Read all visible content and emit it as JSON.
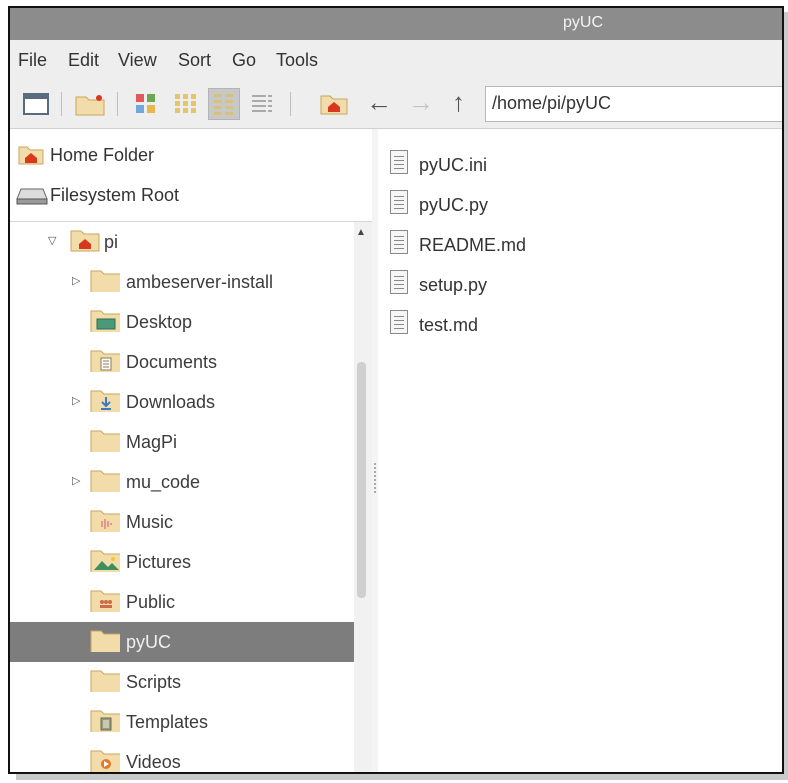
{
  "window": {
    "title": "pyUC"
  },
  "menu": [
    "File",
    "Edit",
    "View",
    "Sort",
    "Go",
    "Tools"
  ],
  "toolbar": {
    "path": "/home/pi/pyUC"
  },
  "places": [
    {
      "label": "Home Folder",
      "icon": "home-folder-icon"
    },
    {
      "label": "Filesystem Root",
      "icon": "drive-icon"
    }
  ],
  "tree": [
    {
      "label": "pi",
      "expander": "expanded",
      "icon": "home-folder-icon"
    },
    {
      "label": "ambeserver-install",
      "expander": "collapsed",
      "icon": "folder-icon"
    },
    {
      "label": "Desktop",
      "expander": "none",
      "icon": "desktop-folder-icon"
    },
    {
      "label": "Documents",
      "expander": "none",
      "icon": "documents-folder-icon"
    },
    {
      "label": "Downloads",
      "expander": "collapsed",
      "icon": "downloads-folder-icon"
    },
    {
      "label": "MagPi",
      "expander": "none",
      "icon": "folder-icon"
    },
    {
      "label": "mu_code",
      "expander": "collapsed",
      "icon": "folder-icon"
    },
    {
      "label": "Music",
      "expander": "none",
      "icon": "music-folder-icon"
    },
    {
      "label": "Pictures",
      "expander": "none",
      "icon": "pictures-folder-icon"
    },
    {
      "label": "Public",
      "expander": "none",
      "icon": "public-folder-icon"
    },
    {
      "label": "pyUC",
      "expander": "none",
      "icon": "folder-icon",
      "selected": true
    },
    {
      "label": "Scripts",
      "expander": "none",
      "icon": "folder-icon"
    },
    {
      "label": "Templates",
      "expander": "none",
      "icon": "templates-folder-icon"
    },
    {
      "label": "Videos",
      "expander": "none",
      "icon": "videos-folder-icon"
    }
  ],
  "files": [
    "pyUC.ini",
    "pyUC.py",
    "README.md",
    "setup.py",
    "test.md"
  ],
  "colors": {
    "titlebar": "#8c8c8c",
    "selection": "#7d7d7d",
    "folder": "#f2ddaa",
    "home_accent": "#d9381e"
  }
}
